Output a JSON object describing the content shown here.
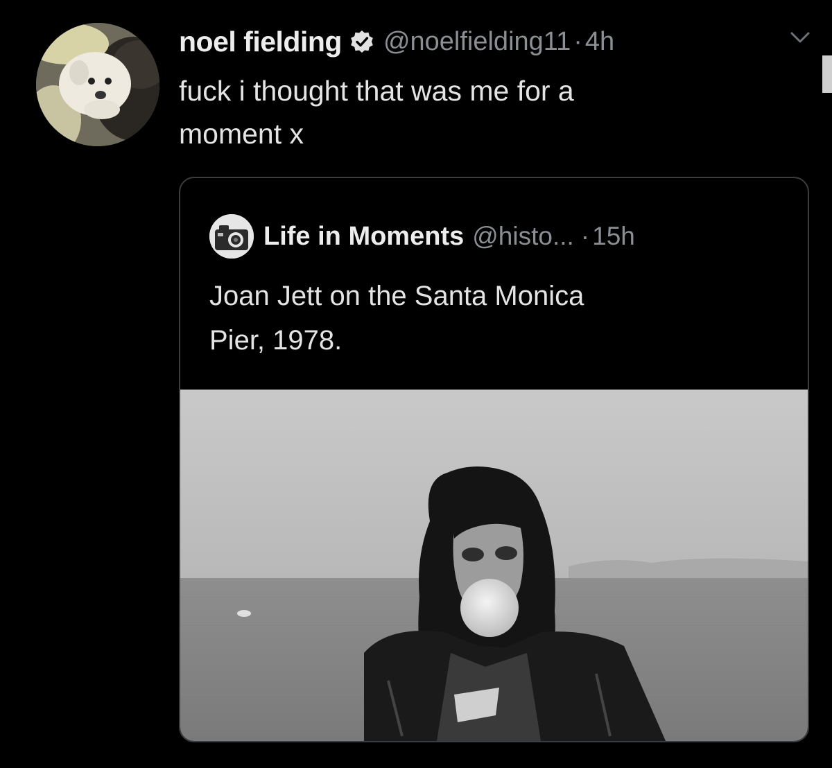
{
  "tweet": {
    "display_name": "noel fielding",
    "handle": "@noelfielding11",
    "separator": "·",
    "time": "4h",
    "text_line1": "fuck i thought that was me for a",
    "text_line2": "moment x",
    "avatar_icon": "dog-photo-avatar",
    "verified_icon": "verified-badge-icon",
    "menu_icon": "chevron-down-icon"
  },
  "quoted_tweet": {
    "display_name": "Life in Moments",
    "handle": "@histo...",
    "separator": "·",
    "time": "15h",
    "text_line1": "Joan Jett on the Santa Monica",
    "text_line2": "Pier, 1978.",
    "avatar_icon": "camera-avatar"
  },
  "colors": {
    "background": "#000000",
    "primary_text": "#e7e9ea",
    "secondary_text": "#8b8f93",
    "border": "#3a3d40"
  }
}
